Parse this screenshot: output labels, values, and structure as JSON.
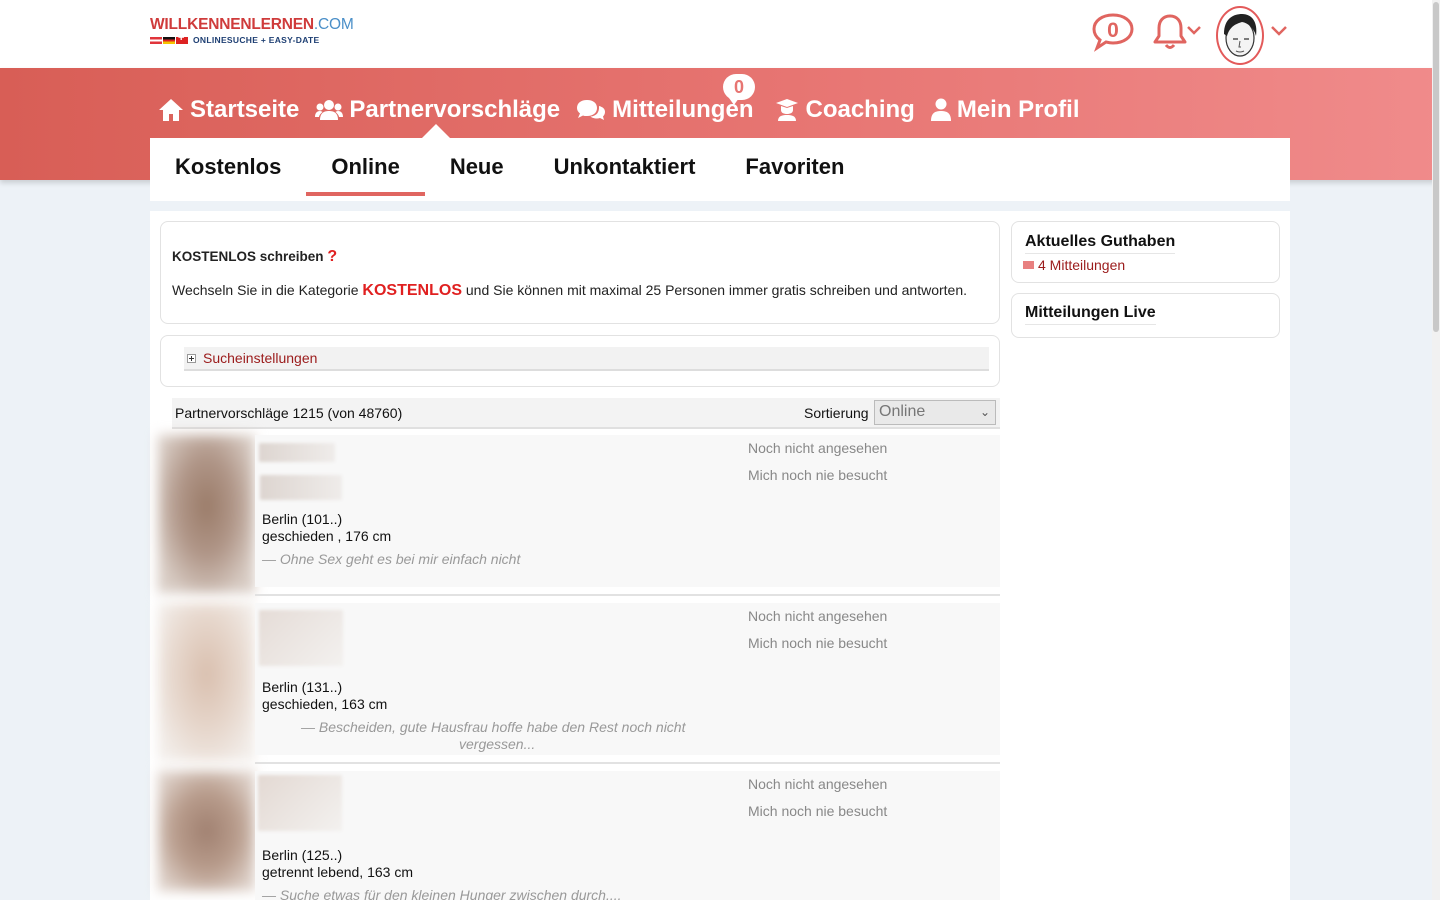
{
  "header": {
    "logo_main": "WILLKENNENLERNEN",
    "logo_com": ".COM",
    "logo_tagline": "ONLINESUCHE + EASY-DATE",
    "chat_count": "0"
  },
  "main_nav": {
    "items": [
      {
        "label": "Startseite",
        "icon": "home-icon"
      },
      {
        "label": "Partnervorschläge",
        "icon": "users-icon"
      },
      {
        "label": "Mitteilungen",
        "icon": "comments-icon"
      },
      {
        "label": "Coaching",
        "icon": "teacher-icon"
      },
      {
        "label": "Mein Profil",
        "icon": "user-icon"
      }
    ],
    "messages_badge": "0"
  },
  "sub_nav": {
    "items": [
      "Kostenlos",
      "Online",
      "Neue",
      "Unkontaktiert",
      "Favoriten"
    ],
    "active": "Online"
  },
  "info": {
    "title": "KOSTENLOS schreiben",
    "question_mark": "?",
    "text_before": "Wechseln Sie in die Kategorie ",
    "highlight": "KOSTENLOS",
    "text_after": " und Sie können mit maximal 25 Personen immer gratis schreiben und antworten."
  },
  "search": {
    "label": "Sucheinstellungen"
  },
  "results": {
    "count_text": "Partnervorschläge 1215 (von 48760)",
    "sort_label": "Sortierung",
    "sort_value": "Online"
  },
  "cards": [
    {
      "city": "Berlin (101..)",
      "status": "geschieden , 176 cm",
      "quote": "—  Ohne Sex geht es bei mir einfach nicht",
      "seen": "Noch nicht angesehen",
      "visited": "Mich noch nie besucht"
    },
    {
      "city": "Berlin (131..)",
      "status": "geschieden, 163 cm",
      "quote_line1": "—  Bescheiden, gute Hausfrau hoffe habe den Rest noch nicht",
      "quote_line2": "vergessen...",
      "seen": "Noch nicht angesehen",
      "visited": "Mich noch nie besucht"
    },
    {
      "city": "Berlin (125..)",
      "status": "getrennt lebend, 163 cm",
      "quote": "—  Suche etwas für den kleinen Hunger zwischen durch....",
      "seen": "Noch nicht angesehen",
      "visited": "Mich noch nie besucht"
    }
  ],
  "sidebar": {
    "balance_title": "Aktuelles Guthaben",
    "balance_link": "4 Mitteilungen",
    "live_title": "Mitteilungen Live"
  },
  "colors": {
    "accent": "#e06560",
    "brand_red": "#cf3b3b",
    "link": "#9b1b1b"
  }
}
